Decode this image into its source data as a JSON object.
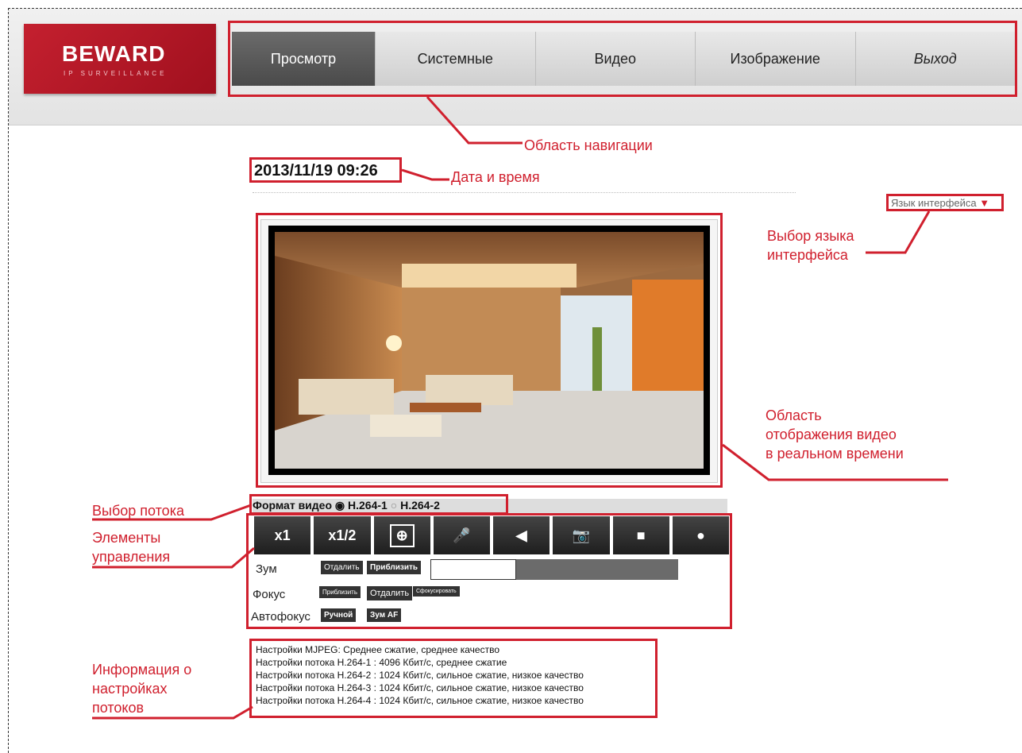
{
  "logo": {
    "brand": "BEWARD",
    "sub": "IP SURVEILLANCE"
  },
  "nav": {
    "items": [
      {
        "label": "Просмотр"
      },
      {
        "label": "Системные"
      },
      {
        "label": "Видео"
      },
      {
        "label": "Изображение"
      },
      {
        "label": "Выход"
      }
    ]
  },
  "datetime": "2013/11/19 09:26",
  "language": {
    "label": "Язык интерфейса"
  },
  "format": {
    "label": "Формат видео",
    "options": [
      {
        "label": "H.264-1",
        "selected": true
      },
      {
        "label": "H.264-2",
        "selected": false
      }
    ]
  },
  "controls": {
    "x1": "x1",
    "x12": "x1/2",
    "zoom_label": "Зум",
    "zoom_out": "Отдалить",
    "zoom_in": "Приблизить",
    "focus_label": "Фокус",
    "focus_near": "Приблизить",
    "focus_far": "Отдалить",
    "focus_do": "Сфокусировать",
    "af_label": "Автофокус",
    "af_manual": "Ручной",
    "af_zoom": "Зум AF"
  },
  "info": {
    "lines": [
      "Настройки MJPEG: Среднее сжатие, среднее качество",
      "Настройки потока H.264-1 : 4096 Кбит/с, среднее сжатие",
      "Настройки потока H.264-2 : 1024 Кбит/с, сильное сжатие, низкое качество",
      "Настройки потока H.264-3 : 1024 Кбит/с, сильное сжатие, низкое качество",
      "Настройки потока H.264-4 : 1024 Кбит/с, сильное сжатие, низкое качество"
    ]
  },
  "callouts": {
    "nav": "Область навигации",
    "datetime": "Дата и время",
    "lang_1": "Выбор языка",
    "lang_2": "интерфейса",
    "video_1": "Область",
    "video_2": "отображения видео",
    "video_3": "в реальном времени",
    "stream": "Выбор потока",
    "controls_1": "Элементы",
    "controls_2": "управления",
    "info_1": "Информация о",
    "info_2": "настройках",
    "info_3": "потоков"
  },
  "colors": {
    "accent": "#d0202e",
    "brand": "#b01624"
  }
}
